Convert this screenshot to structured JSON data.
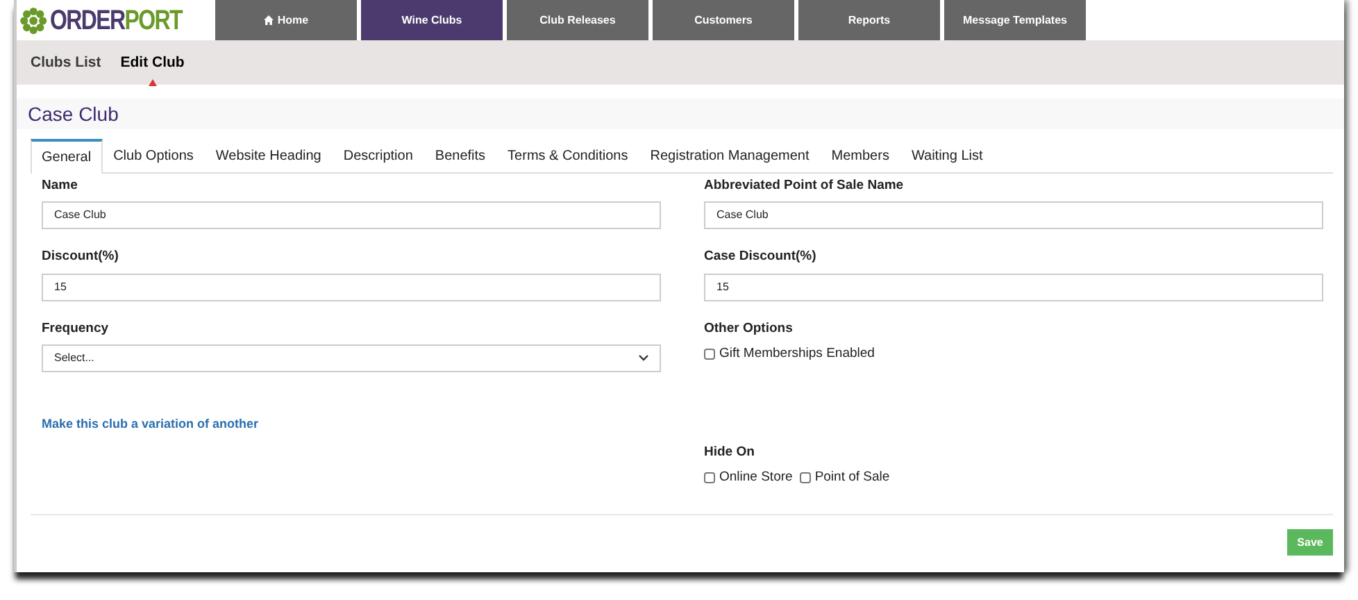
{
  "logo": {
    "parts": [
      "ORDER",
      "PORT"
    ]
  },
  "main_nav": [
    {
      "kind": "home",
      "label": "Home",
      "selected": false
    },
    {
      "kind": "text",
      "label": "Wine Clubs",
      "selected": true
    },
    {
      "kind": "text",
      "label": "Club Releases",
      "selected": false
    },
    {
      "kind": "text",
      "label": "Customers",
      "selected": false
    },
    {
      "kind": "text",
      "label": "Reports",
      "selected": false
    },
    {
      "kind": "text",
      "label": "Message Templates",
      "selected": false
    }
  ],
  "sub_nav": [
    {
      "label": "Clubs List",
      "selected": false
    },
    {
      "label": "Edit Club",
      "selected": true
    }
  ],
  "page_title": "Case Club",
  "tabs": [
    {
      "label": "General",
      "selected": true
    },
    {
      "label": "Club Options",
      "selected": false
    },
    {
      "label": "Website Heading",
      "selected": false
    },
    {
      "label": "Description",
      "selected": false
    },
    {
      "label": "Benefits",
      "selected": false
    },
    {
      "label": "Terms & Conditions",
      "selected": false
    },
    {
      "label": "Registration Management",
      "selected": false
    },
    {
      "label": "Members",
      "selected": false
    },
    {
      "label": "Waiting List",
      "selected": false
    }
  ],
  "left_fields": [
    {
      "kind": "input",
      "label": "Name",
      "value": "Case Club"
    },
    {
      "kind": "input",
      "label": "Discount(%)",
      "value": "15"
    },
    {
      "kind": "select",
      "label": "Frequency",
      "value": "Select..."
    }
  ],
  "variation_link": "Make this club a variation of another",
  "right_fields": [
    {
      "kind": "input",
      "label": "Abbreviated Point of Sale Name",
      "value": "Case Club"
    },
    {
      "kind": "input",
      "label": "Case Discount(%)",
      "value": "15"
    },
    {
      "kind": "checks",
      "label": "Other Options",
      "options": [
        {
          "label": "Gift Memberships Enabled",
          "checked": false
        }
      ]
    },
    {
      "kind": "checks",
      "label": "Hide On",
      "options": [
        {
          "label": "Online Store",
          "checked": false
        },
        {
          "label": "Point of Sale",
          "checked": false
        }
      ]
    }
  ],
  "save_button": "Save"
}
